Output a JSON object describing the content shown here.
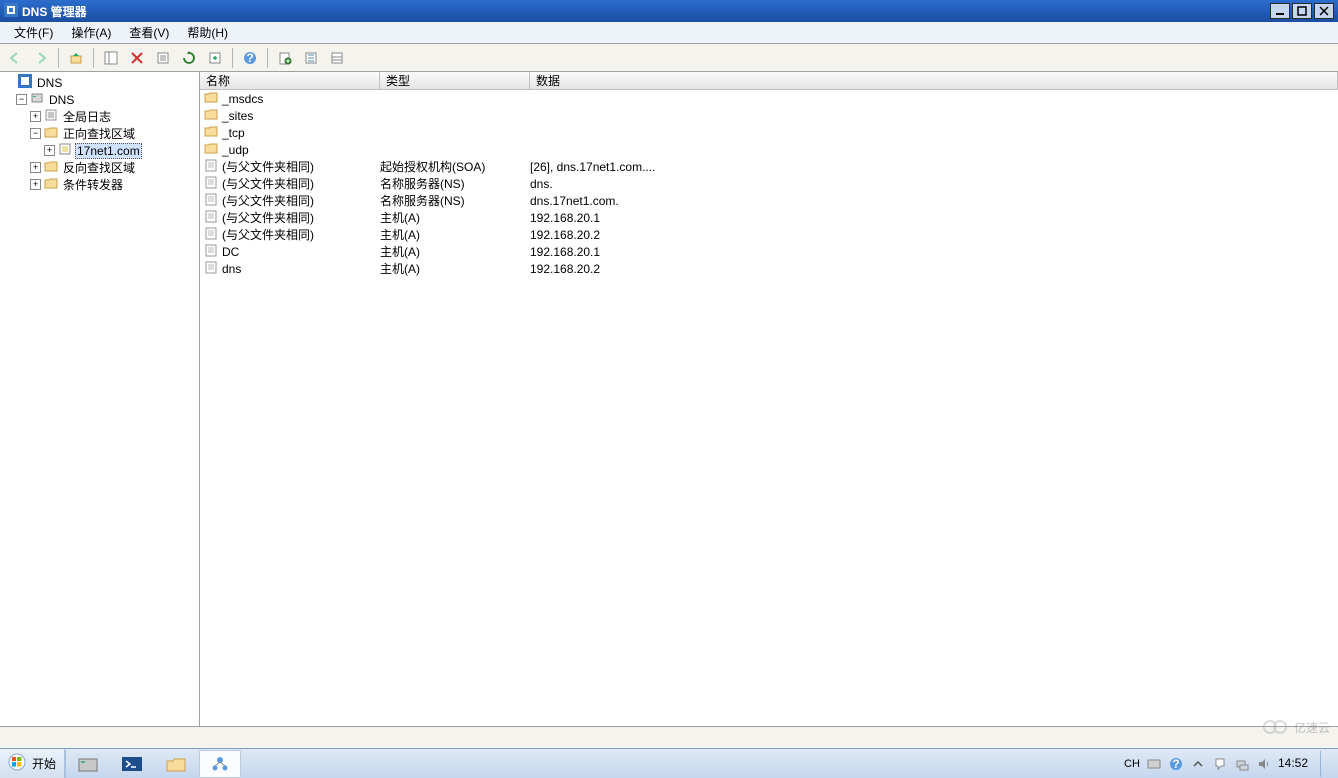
{
  "window": {
    "title": "DNS 管理器"
  },
  "menu": {
    "file": "文件(F)",
    "action": "操作(A)",
    "view": "查看(V)",
    "help": "帮助(H)"
  },
  "tree": {
    "root": "DNS",
    "server": "DNS",
    "items": {
      "global_log": "全局日志",
      "fwd_zone": "正向查找区域",
      "selected_zone": "17net1.com",
      "rev_zone": "反向查找区域",
      "cond_fwd": "条件转发器"
    }
  },
  "columns": {
    "name": "名称",
    "type": "类型",
    "data": "数据"
  },
  "records": [
    {
      "kind": "folder",
      "name": "_msdcs",
      "type": "",
      "data": ""
    },
    {
      "kind": "folder",
      "name": "_sites",
      "type": "",
      "data": ""
    },
    {
      "kind": "folder",
      "name": "_tcp",
      "type": "",
      "data": ""
    },
    {
      "kind": "folder",
      "name": "_udp",
      "type": "",
      "data": ""
    },
    {
      "kind": "rec",
      "name": "(与父文件夹相同)",
      "type": "起始授权机构(SOA)",
      "data": "[26], dns.17net1.com...."
    },
    {
      "kind": "rec",
      "name": "(与父文件夹相同)",
      "type": "名称服务器(NS)",
      "data": "dns."
    },
    {
      "kind": "rec",
      "name": "(与父文件夹相同)",
      "type": "名称服务器(NS)",
      "data": "dns.17net1.com."
    },
    {
      "kind": "rec",
      "name": "(与父文件夹相同)",
      "type": "主机(A)",
      "data": "192.168.20.1"
    },
    {
      "kind": "rec",
      "name": "(与父文件夹相同)",
      "type": "主机(A)",
      "data": "192.168.20.2"
    },
    {
      "kind": "rec",
      "name": "DC",
      "type": "主机(A)",
      "data": "192.168.20.1"
    },
    {
      "kind": "rec",
      "name": "dns",
      "type": "主机(A)",
      "data": "192.168.20.2"
    }
  ],
  "taskbar": {
    "start": "开始",
    "ime": "CH",
    "time": "14:52"
  },
  "watermark": "亿速云"
}
